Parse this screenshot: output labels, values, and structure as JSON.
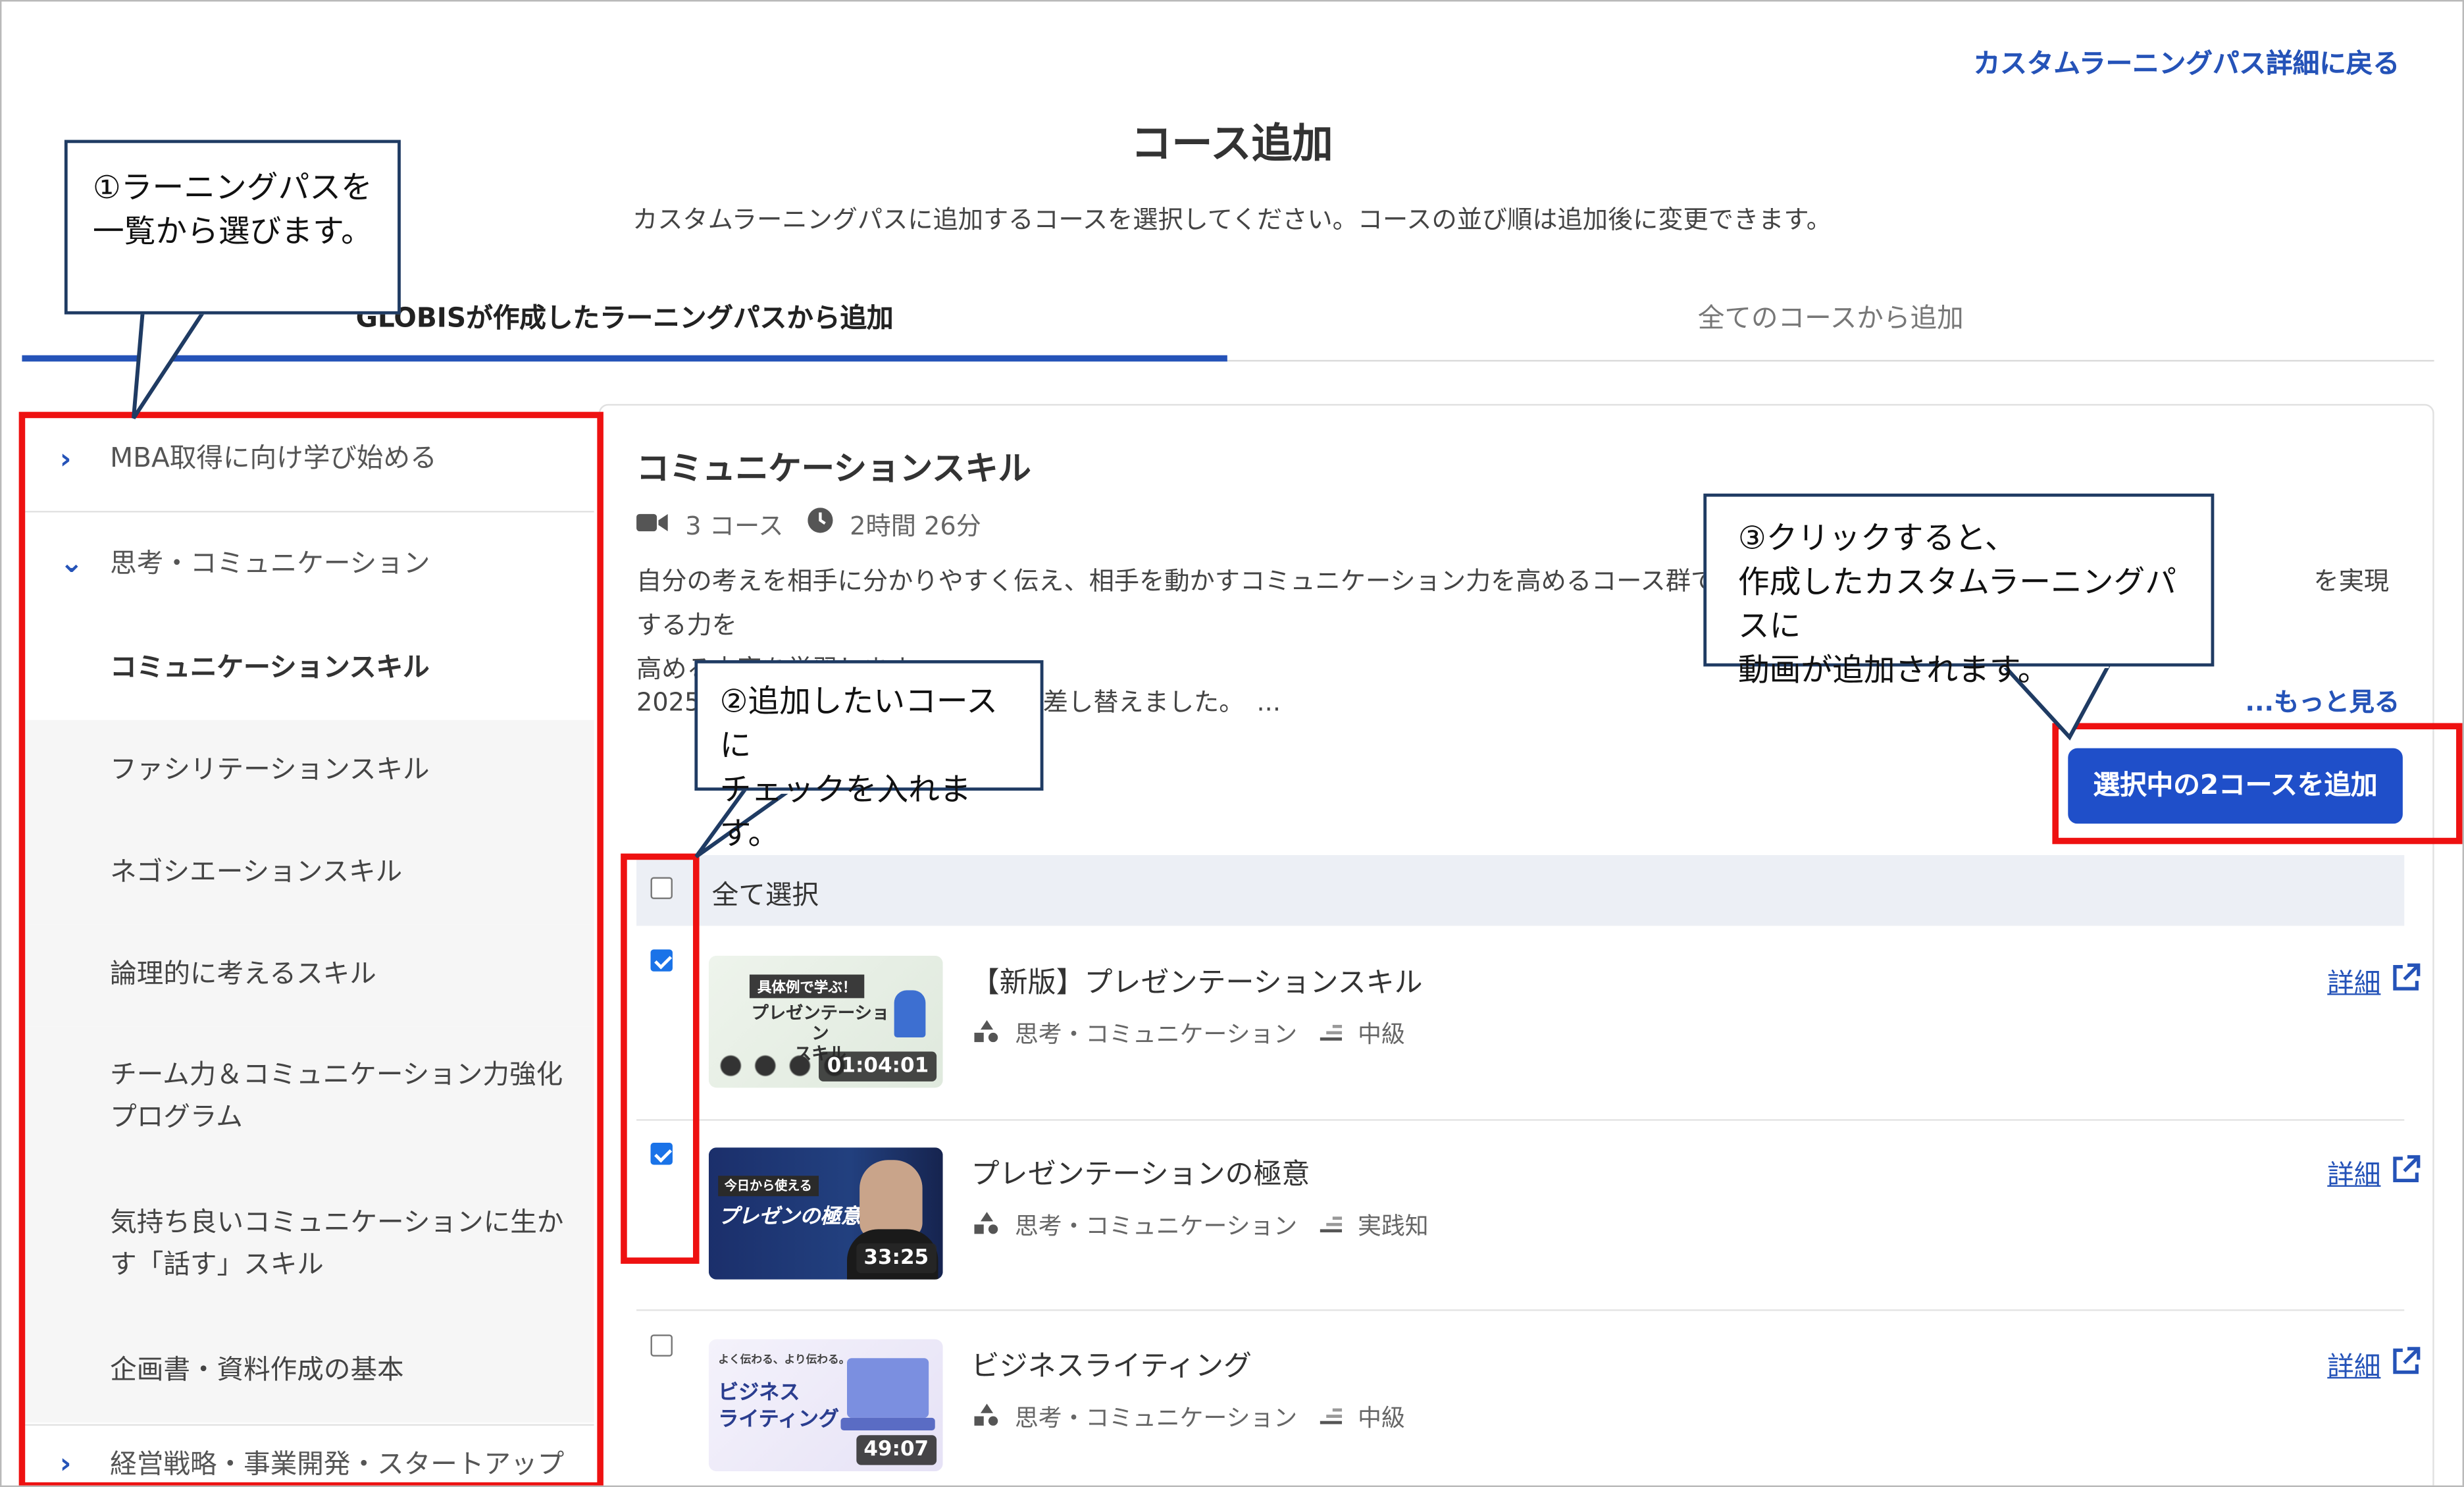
{
  "header": {
    "back_link": "カスタムラーニングパス詳細に戻る",
    "title": "コース追加",
    "subtitle": "カスタムラーニングパスに追加するコースを選択してください。コースの並び順は追加後に変更できます。"
  },
  "tabs": [
    {
      "label": "GLOBISが作成したラーニングパスから追加",
      "active": true
    },
    {
      "label": "全てのコースから追加",
      "active": false
    }
  ],
  "sidebar": {
    "groups": [
      {
        "label": "MBA取得に向け学び始める",
        "expanded": false
      },
      {
        "label": "思考・コミュニケーション",
        "expanded": true,
        "items": [
          {
            "label": "コミュニケーションスキル",
            "selected": true
          },
          {
            "label": "ファシリテーションスキル"
          },
          {
            "label": "ネゴシエーションスキル"
          },
          {
            "label": "論理的に考えるスキル"
          },
          {
            "label": "チーム力＆コミュニケーション力強化プログラム"
          },
          {
            "label": "気持ち良いコミュニケーションに生かす「話す」スキル"
          },
          {
            "label": "企画書・資料作成の基本"
          }
        ]
      },
      {
        "label": "経営戦略・事業開発・スタートアップ",
        "expanded": false
      }
    ]
  },
  "path": {
    "title": "コミュニケーションスキル",
    "course_count": "3 コース",
    "duration": "2時間 26分",
    "description_line1_a": "自分の考えを相手に分かりやすく伝え、相手を動かすコミュニケーション力を高めるコース群です。",
    "description_line1_b": "を実現する力を",
    "description_line2": "高める内容を学習します。",
    "update_a": "2025",
    "update_b": "差し替えました。　...",
    "more_link": "...もっと見る",
    "add_button": "選択中の2コースを追加"
  },
  "select_all": {
    "label": "全て選択",
    "checked": false
  },
  "courses": [
    {
      "title": "【新版】プレゼンテーションスキル",
      "category": "思考・コミュニケーション",
      "level": "中級",
      "duration": "01:04:01",
      "checked": true,
      "detail": "詳細",
      "thumb_tag": "具体例で学ぶ！",
      "thumb_title": "プレゼンテーション\nスキル"
    },
    {
      "title": "プレゼンテーションの極意",
      "category": "思考・コミュニケーション",
      "level": "実践知",
      "duration": "33:25",
      "checked": true,
      "detail": "詳細",
      "thumb_tag": "今日から使える",
      "thumb_title": "プレゼンの極意"
    },
    {
      "title": "ビジネスライティング",
      "category": "思考・コミュニケーション",
      "level": "中級",
      "duration": "49:07",
      "checked": false,
      "detail": "詳細",
      "thumb_tag": "よく伝わる、より伝わる。",
      "thumb_title": "ビジネス\nライティング"
    }
  ],
  "annotations": {
    "callout1": [
      "①ラーニングパスを",
      "一覧から選びます。"
    ],
    "callout2": [
      "②追加したいコースに",
      "チェックを入れます。"
    ],
    "callout3": [
      "③クリックすると、",
      "作成したカスタムラーニングパスに",
      "動画が追加されます。"
    ]
  },
  "colors": {
    "accent": "#1f4fc9",
    "link": "#2553b8",
    "annotation_red": "#ee1111",
    "callout_border": "#1f3b63"
  }
}
